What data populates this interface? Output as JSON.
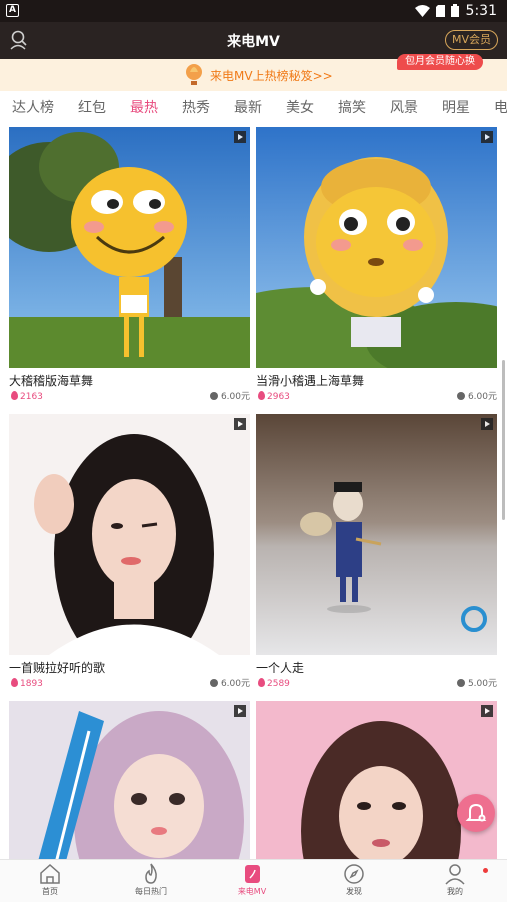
{
  "status_bar": {
    "app_badge": "A",
    "time": "5:31"
  },
  "header": {
    "title": "来电MV",
    "mv_button": "MV会员"
  },
  "banner": {
    "text": "来电MV上热榜秘笈>>",
    "tag": "包月会员随心换"
  },
  "tabs": [
    {
      "label": "达人榜",
      "active": false
    },
    {
      "label": "红包",
      "active": false
    },
    {
      "label": "最热",
      "active": true
    },
    {
      "label": "热秀",
      "active": false
    },
    {
      "label": "最新",
      "active": false
    },
    {
      "label": "美女",
      "active": false
    },
    {
      "label": "搞笑",
      "active": false
    },
    {
      "label": "风景",
      "active": false
    },
    {
      "label": "明星",
      "active": false
    },
    {
      "label": "电",
      "active": false
    }
  ],
  "videos": [
    {
      "title": "大稽稽版海草舞",
      "likes": "2163",
      "price": "6.00元"
    },
    {
      "title": "当滑小稽遇上海草舞",
      "likes": "2963",
      "price": "6.00元"
    },
    {
      "title": "一首贼拉好听的歌",
      "likes": "1893",
      "price": "6.00元"
    },
    {
      "title": "一个人走",
      "likes": "2589",
      "price": "5.00元"
    },
    {
      "title": "",
      "likes": "",
      "price": ""
    },
    {
      "title": "",
      "likes": "",
      "price": ""
    }
  ],
  "bottom_nav": [
    {
      "label": "首页",
      "icon": "home-icon"
    },
    {
      "label": "每日热门",
      "icon": "flame-icon"
    },
    {
      "label": "来电MV",
      "icon": "mv-phone-icon",
      "active": true
    },
    {
      "label": "发现",
      "icon": "compass-icon"
    },
    {
      "label": "我的",
      "icon": "person-icon"
    }
  ],
  "colors": {
    "accent": "#e84c7f",
    "header_bg": "#2a2322",
    "banner_bg": "#fdf1de",
    "banner_text": "#f07a18",
    "gold": "#d7a65a"
  }
}
